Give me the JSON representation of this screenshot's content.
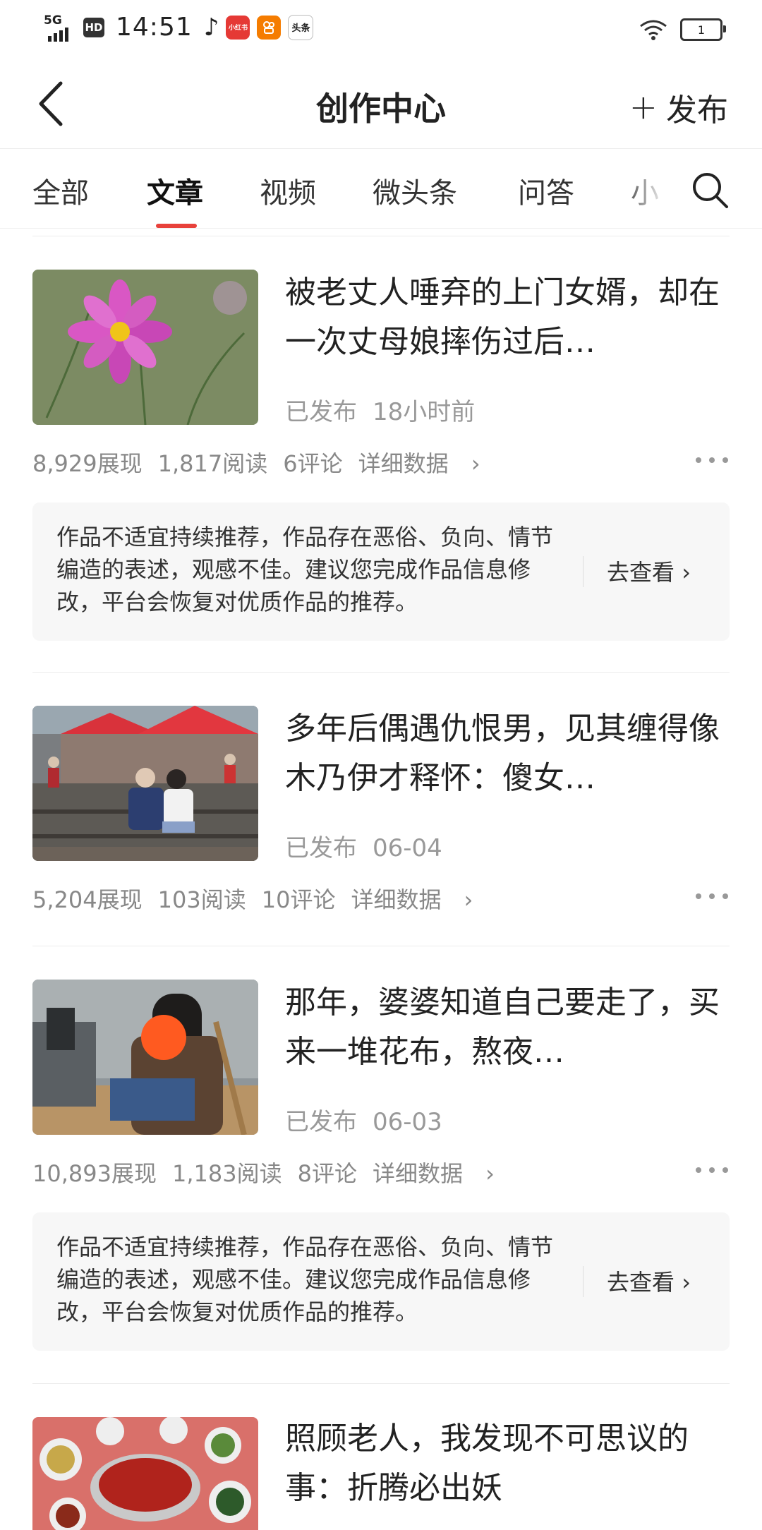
{
  "status_bar": {
    "network": "5G",
    "hd": "HD",
    "time": "14:51",
    "app_icons": [
      "小红书",
      "快手",
      "头条"
    ],
    "battery": "1"
  },
  "header": {
    "title": "创作中心",
    "publish_label": "发布"
  },
  "tabs": [
    {
      "label": "全部",
      "active": false
    },
    {
      "label": "文章",
      "active": true
    },
    {
      "label": "视频",
      "active": false
    },
    {
      "label": "微头条",
      "active": false
    },
    {
      "label": "问答",
      "active": false
    },
    {
      "label": "小",
      "active": false
    }
  ],
  "accent_color": "#e8413b",
  "articles": [
    {
      "title": "被老丈人唾弃的上门女婿，却在一次丈母娘摔伤过后…",
      "status": "已发布",
      "time": "18小时前",
      "impressions": "8,929展现",
      "reads": "1,817阅读",
      "comments": "6评论",
      "detail": "详细数据",
      "thumb": "pink-flower"
    },
    {
      "title": "多年后偶遇仇恨男，见其缠得像木乃伊才释怀：傻女…",
      "status": "已发布",
      "time": "06-04",
      "impressions": "5,204展现",
      "reads": "103阅读",
      "comments": "10评论",
      "detail": "详细数据",
      "thumb": "market-railway"
    },
    {
      "title": "那年，婆婆知道自己要走了，买来一堆花布，熬夜…",
      "status": "已发布",
      "time": "06-03",
      "impressions": "10,893展现",
      "reads": "1,183阅读",
      "comments": "8评论",
      "detail": "详细数据",
      "thumb": "sewing-machine"
    },
    {
      "title": "照顾老人，我发现不可思议的事：折腾必出妖",
      "thumb": "dinner-table"
    }
  ],
  "notice": {
    "text": "作品不适宜持续推荐，作品存在恶俗、负向、情节编造的表述，观感不佳。建议您完成作品信息修改，平台会恢复对优质作品的推荐。",
    "button": "去查看"
  }
}
